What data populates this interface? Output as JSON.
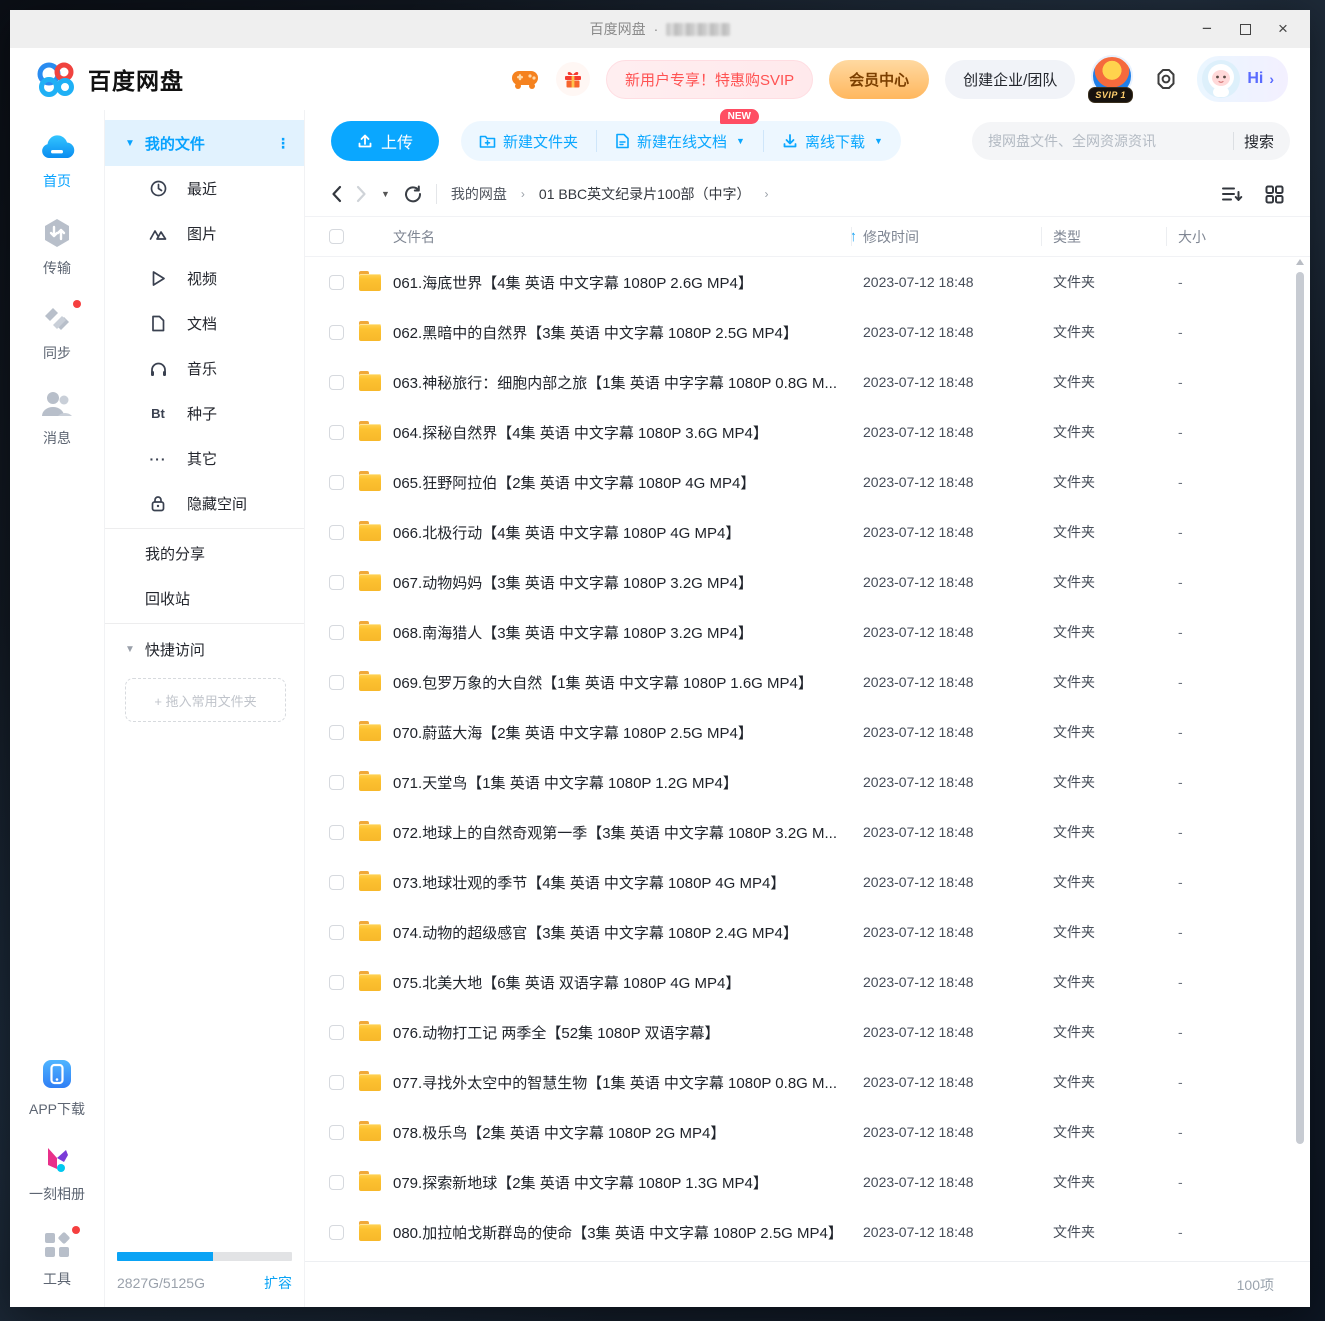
{
  "window": {
    "title": "百度网盘",
    "separator": "·"
  },
  "header": {
    "logo_text": "百度网盘",
    "promo_pill": "新用户专享！特惠购SVIP",
    "vip_button": "会员中心",
    "team_button": "创建企业/团队",
    "svip_badge": "SVIP 1",
    "greeting": "Hi"
  },
  "nav_rail": {
    "home": "首页",
    "transfer": "传输",
    "sync": "同步",
    "messages": "消息",
    "app_download": "APP下载",
    "photo_album": "一刻相册",
    "tools": "工具"
  },
  "sidebar": {
    "my_files": "我的文件",
    "categories": [
      {
        "label": "最近",
        "icon": "clock-icon"
      },
      {
        "label": "图片",
        "icon": "image-icon"
      },
      {
        "label": "视频",
        "icon": "video-icon"
      },
      {
        "label": "文档",
        "icon": "document-icon"
      },
      {
        "label": "音乐",
        "icon": "music-icon"
      },
      {
        "label": "种子",
        "icon": "bt-icon",
        "glyph": "Bt"
      },
      {
        "label": "其它",
        "icon": "more-icon",
        "glyph": "···"
      },
      {
        "label": "隐藏空间",
        "icon": "lock-icon"
      }
    ],
    "my_share": "我的分享",
    "recycle_bin": "回收站",
    "quick_access": "快捷访问",
    "dropzone": "+ 拖入常用文件夹",
    "storage": {
      "used_total": "2827G/5125G",
      "expand": "扩容",
      "percent": 55
    }
  },
  "toolbar": {
    "upload": "上传",
    "new_folder": "新建文件夹",
    "new_online_doc": "新建在线文档",
    "new_badge": "NEW",
    "offline_download": "离线下载"
  },
  "search": {
    "placeholder": "搜网盘文件、全网资源资讯",
    "button": "搜索"
  },
  "breadcrumb": {
    "root": "我的网盘",
    "current": "01 BBC英文纪录片100部（中字）"
  },
  "table": {
    "columns": {
      "name": "文件名",
      "modified": "修改时间",
      "type": "类型",
      "size": "大小"
    },
    "rows": [
      {
        "name": "061.海底世界【4集 英语 中文字幕 1080P 2.6G MP4】",
        "date": "2023-07-12 18:48",
        "type": "文件夹",
        "size": "-"
      },
      {
        "name": "062.黑暗中的自然界【3集 英语 中文字幕 1080P 2.5G MP4】",
        "date": "2023-07-12 18:48",
        "type": "文件夹",
        "size": "-"
      },
      {
        "name": "063.神秘旅行：细胞内部之旅【1集 英语 中字字幕 1080P 0.8G M...",
        "date": "2023-07-12 18:48",
        "type": "文件夹",
        "size": "-"
      },
      {
        "name": "064.探秘自然界【4集 英语 中文字幕 1080P 3.6G MP4】",
        "date": "2023-07-12 18:48",
        "type": "文件夹",
        "size": "-"
      },
      {
        "name": "065.狂野阿拉伯【2集 英语 中文字幕 1080P 4G MP4】",
        "date": "2023-07-12 18:48",
        "type": "文件夹",
        "size": "-"
      },
      {
        "name": "066.北极行动【4集 英语 中文字幕 1080P 4G MP4】",
        "date": "2023-07-12 18:48",
        "type": "文件夹",
        "size": "-"
      },
      {
        "name": "067.动物妈妈【3集 英语 中文字幕 1080P 3.2G MP4】",
        "date": "2023-07-12 18:48",
        "type": "文件夹",
        "size": "-"
      },
      {
        "name": "068.南海猎人【3集 英语 中文字幕 1080P 3.2G MP4】",
        "date": "2023-07-12 18:48",
        "type": "文件夹",
        "size": "-"
      },
      {
        "name": "069.包罗万象的大自然【1集 英语 中文字幕 1080P 1.6G MP4】",
        "date": "2023-07-12 18:48",
        "type": "文件夹",
        "size": "-"
      },
      {
        "name": "070.蔚蓝大海【2集 英语 中文字幕 1080P 2.5G MP4】",
        "date": "2023-07-12 18:48",
        "type": "文件夹",
        "size": "-"
      },
      {
        "name": "071.天堂鸟【1集 英语 中文字幕 1080P 1.2G MP4】",
        "date": "2023-07-12 18:48",
        "type": "文件夹",
        "size": "-"
      },
      {
        "name": "072.地球上的自然奇观第一季【3集 英语 中文字幕 1080P 3.2G M...",
        "date": "2023-07-12 18:48",
        "type": "文件夹",
        "size": "-"
      },
      {
        "name": "073.地球壮观的季节【4集 英语 中文字幕 1080P 4G MP4】",
        "date": "2023-07-12 18:48",
        "type": "文件夹",
        "size": "-"
      },
      {
        "name": "074.动物的超级感官【3集 英语 中文字幕 1080P 2.4G MP4】",
        "date": "2023-07-12 18:48",
        "type": "文件夹",
        "size": "-"
      },
      {
        "name": "075.北美大地【6集 英语 双语字幕 1080P 4G MP4】",
        "date": "2023-07-12 18:48",
        "type": "文件夹",
        "size": "-"
      },
      {
        "name": "076.动物打工记 两季全【52集 1080P 双语字幕】",
        "date": "2023-07-12 18:48",
        "type": "文件夹",
        "size": "-"
      },
      {
        "name": "077.寻找外太空中的智慧生物【1集 英语 中文字幕 1080P 0.8G M...",
        "date": "2023-07-12 18:48",
        "type": "文件夹",
        "size": "-"
      },
      {
        "name": "078.极乐鸟【2集 英语 中文字幕 1080P 2G MP4】",
        "date": "2023-07-12 18:48",
        "type": "文件夹",
        "size": "-"
      },
      {
        "name": "079.探索新地球【2集 英语 中文字幕 1080P 1.3G MP4】",
        "date": "2023-07-12 18:48",
        "type": "文件夹",
        "size": "-"
      },
      {
        "name": "080.加拉帕戈斯群岛的使命【3集 英语 中文字幕 1080P 2.5G MP4】",
        "date": "2023-07-12 18:48",
        "type": "文件夹",
        "size": "-"
      }
    ]
  },
  "footer": {
    "count": "100项"
  }
}
